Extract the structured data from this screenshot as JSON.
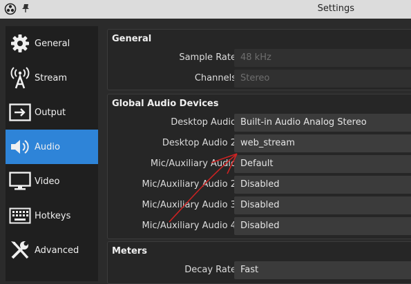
{
  "window": {
    "title": "Settings"
  },
  "sidebar": {
    "items": [
      {
        "label": "General",
        "icon": "gear-icon"
      },
      {
        "label": "Stream",
        "icon": "antenna-icon"
      },
      {
        "label": "Output",
        "icon": "output-icon"
      },
      {
        "label": "Audio",
        "icon": "speaker-icon",
        "active": true
      },
      {
        "label": "Video",
        "icon": "monitor-icon"
      },
      {
        "label": "Hotkeys",
        "icon": "keyboard-icon"
      },
      {
        "label": "Advanced",
        "icon": "tools-icon"
      }
    ]
  },
  "general": {
    "title": "General",
    "sample_rate_label": "Sample Rate",
    "sample_rate_value": "48 kHz",
    "channels_label": "Channels",
    "channels_value": "Stereo"
  },
  "devices": {
    "title": "Global Audio Devices",
    "rows": [
      {
        "label": "Desktop Audio",
        "value": "Built-in Audio Analog Stereo"
      },
      {
        "label": "Desktop Audio 2",
        "value": "web_stream"
      },
      {
        "label": "Mic/Auxiliary Audio",
        "value": "Default"
      },
      {
        "label": "Mic/Auxiliary Audio 2",
        "value": "Disabled"
      },
      {
        "label": "Mic/Auxiliary Audio 3",
        "value": "Disabled"
      },
      {
        "label": "Mic/Auxiliary Audio 4",
        "value": "Disabled"
      }
    ]
  },
  "meters": {
    "title": "Meters",
    "decay_rate_label": "Decay Rate",
    "decay_rate_value": "Fast"
  },
  "colors": {
    "accent": "#2e84d8",
    "annotation": "#cc2222"
  }
}
